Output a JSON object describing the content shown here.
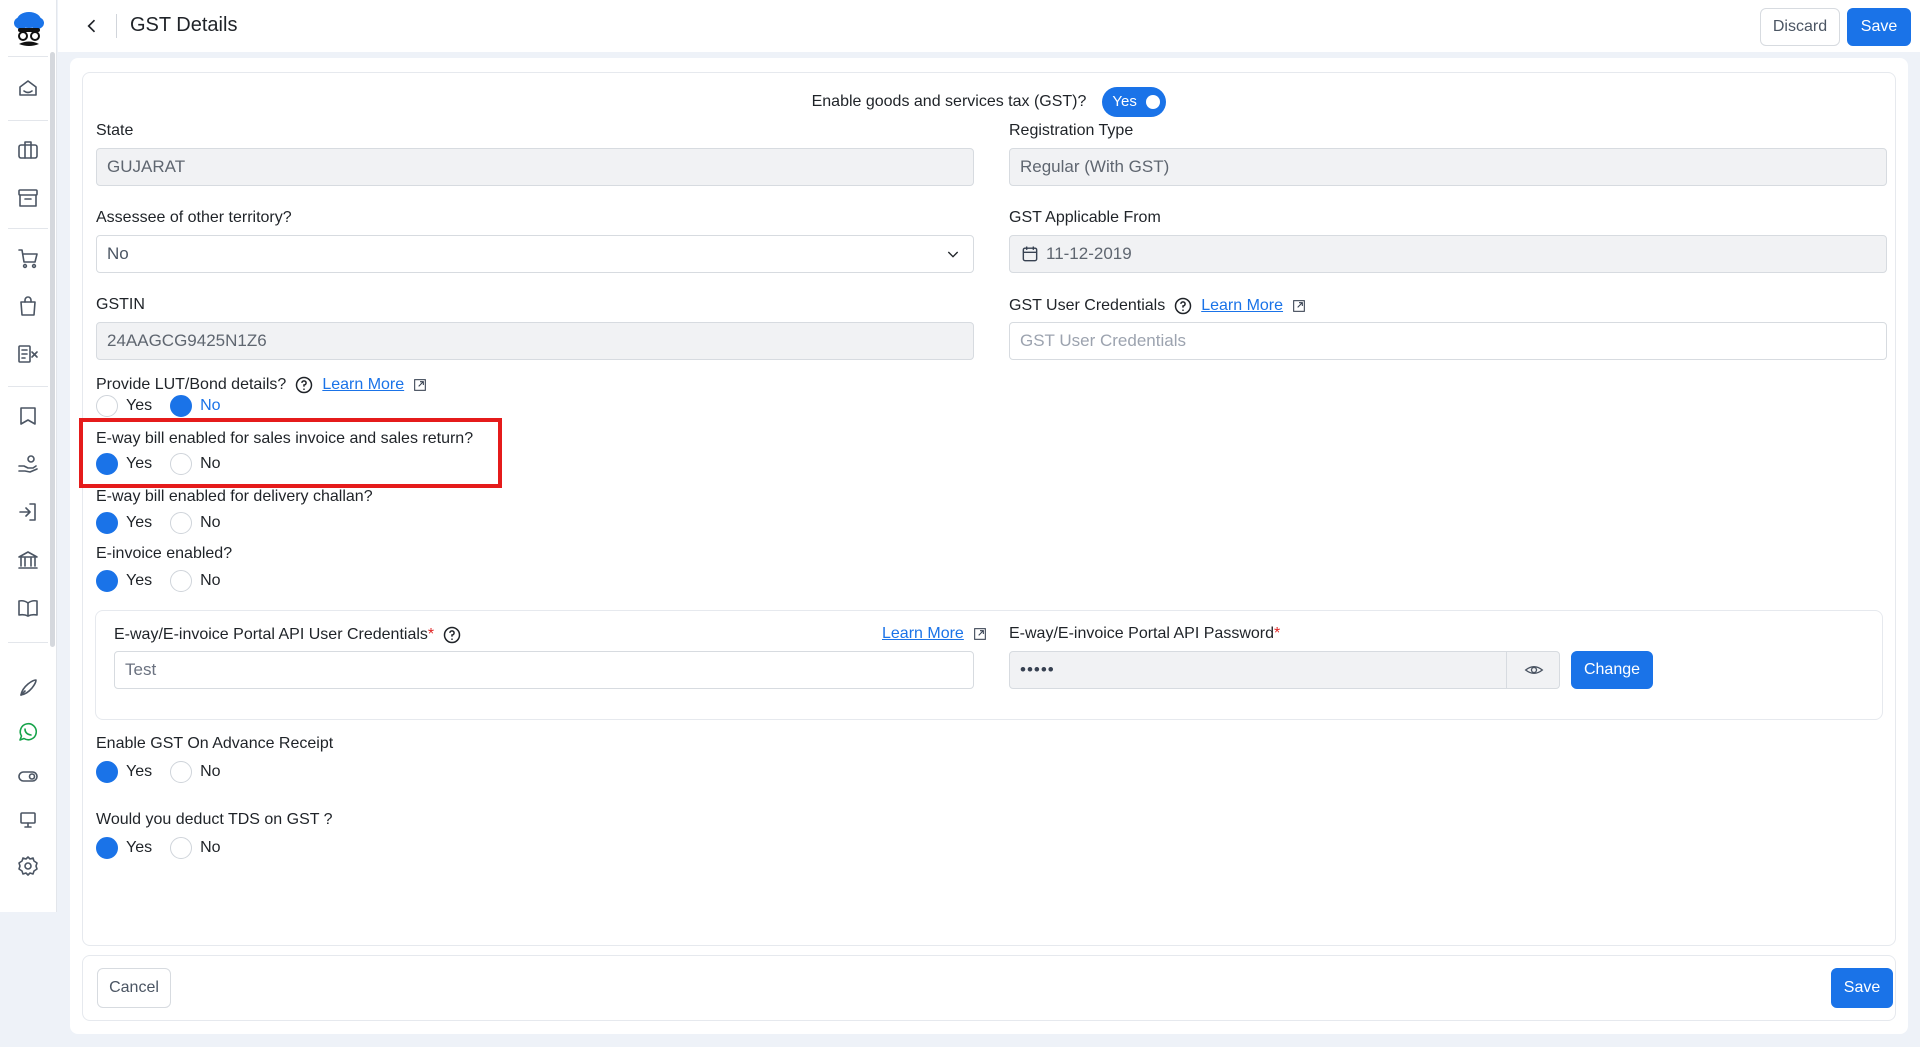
{
  "header": {
    "title": "GST Details",
    "discard_label": "Discard",
    "save_label": "Save"
  },
  "form": {
    "gst_toggle": {
      "label": "Enable goods and services tax (GST)?",
      "value": "Yes"
    },
    "state": {
      "label": "State",
      "value": "GUJARAT"
    },
    "registration_type": {
      "label": "Registration Type",
      "value": "Regular (With GST)"
    },
    "assessee": {
      "label": "Assessee of other territory?",
      "value": "No"
    },
    "gst_applicable_from": {
      "label": "GST Applicable From",
      "value": "11-12-2019"
    },
    "gstin": {
      "label": "GSTIN",
      "value": "24AAGCG9425N1Z6"
    },
    "gst_user_credentials": {
      "label": "GST User Credentials",
      "learn_more": "Learn More",
      "placeholder": "GST User Credentials"
    },
    "lut_bond": {
      "label": "Provide LUT/Bond details?",
      "learn_more": "Learn More",
      "yes": "Yes",
      "no": "No",
      "selected": "No"
    },
    "eway_sales": {
      "label": "E-way bill enabled for sales invoice and sales return?",
      "yes": "Yes",
      "no": "No",
      "selected": "Yes"
    },
    "eway_challan": {
      "label": "E-way bill enabled for delivery challan?",
      "yes": "Yes",
      "no": "No",
      "selected": "Yes"
    },
    "einvoice": {
      "label": "E-invoice enabled?",
      "yes": "Yes",
      "no": "No",
      "selected": "Yes"
    },
    "api_user": {
      "label": "E-way/E-invoice Portal API User Credentials",
      "required": "*",
      "learn_more": "Learn More",
      "value": "Test"
    },
    "api_password": {
      "label": "E-way/E-invoice Portal API Password",
      "required": "*",
      "value": "•••••",
      "change_label": "Change"
    },
    "gst_advance": {
      "label": "Enable GST On Advance Receipt",
      "yes": "Yes",
      "no": "No",
      "selected": "Yes"
    },
    "tds_on_gst": {
      "label": "Would you deduct TDS on GST ?",
      "yes": "Yes",
      "no": "No",
      "selected": "Yes"
    }
  },
  "footer": {
    "cancel_label": "Cancel",
    "save_label": "Save"
  },
  "colors": {
    "primary": "#1a73e8",
    "highlight": "#e51b1b",
    "required": "#e02424"
  },
  "sidebar_icons": [
    "logo-icon",
    "dashboard-icon",
    "briefcase-icon",
    "archive-icon",
    "cart-icon",
    "shopping-bag-icon",
    "accounting-icon",
    "book-icon",
    "hand-coins-icon",
    "logout-icon",
    "bank-icon",
    "open-book-icon",
    "rocket-icon",
    "whatsapp-icon",
    "toggle-icon",
    "monitor-icon",
    "settings-icon"
  ]
}
